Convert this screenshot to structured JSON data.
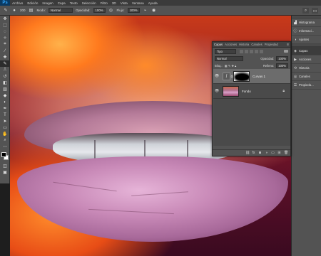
{
  "app": {
    "logo": "Ps"
  },
  "menu": [
    "Archivo",
    "Edición",
    "Imagen",
    "Capa",
    "Texto",
    "Selección",
    "Filtro",
    "3D",
    "Vista",
    "Ventana",
    "Ayuda"
  ],
  "options": {
    "brush_size": "200",
    "mode_label": "Modo:",
    "mode_value": "Normal",
    "opacity_label": "Opacidad:",
    "opacity_value": "100%",
    "flow_label": "Flujo:",
    "flow_value": "100%"
  },
  "dock": {
    "items": [
      {
        "label": "Histograma",
        "icon": "histogram-icon"
      },
      {
        "label": "Informaci...",
        "icon": "info-icon"
      },
      {
        "label": "Ajustes",
        "icon": "adjustments-icon"
      },
      {
        "label": "Capas",
        "icon": "layers-icon"
      },
      {
        "label": "Acciones",
        "icon": "actions-icon"
      },
      {
        "label": "Historia",
        "icon": "history-icon"
      },
      {
        "label": "Canales",
        "icon": "channels-icon"
      },
      {
        "label": "Propieda...",
        "icon": "properties-icon"
      }
    ]
  },
  "layers_panel": {
    "tabs": [
      "Capas",
      "Acciones",
      "Historia",
      "Canales",
      "Propiedad"
    ],
    "filter_kind": "Tipo",
    "blend_mode": "Normal",
    "opacity_label": "Opacidad:",
    "opacity_value": "100%",
    "lock_label": "Bloq.:",
    "fill_label": "Relleno:",
    "fill_value": "100%",
    "layers": [
      {
        "name": "Curvas 1",
        "type": "adjustment",
        "selected": true
      },
      {
        "name": "Fondo",
        "type": "image",
        "selected": false
      }
    ]
  }
}
